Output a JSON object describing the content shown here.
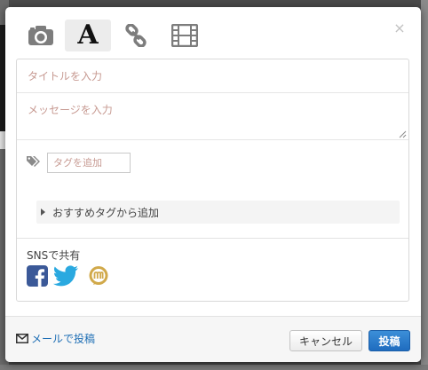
{
  "toolbar": {
    "items": [
      {
        "icon": "camera-icon"
      },
      {
        "icon": "text-icon",
        "glyph": "A",
        "active": true
      },
      {
        "icon": "link-icon"
      },
      {
        "icon": "film-icon"
      }
    ],
    "close_glyph": "×"
  },
  "form": {
    "title_placeholder": "タイトルを入力",
    "message_placeholder": "メッセージを入力",
    "tag_placeholder": "タグを追加",
    "recommend_label": "おすすめタグから追加"
  },
  "share": {
    "label": "SNSで共有",
    "services": [
      "facebook-icon",
      "twitter-icon",
      "mixi-icon"
    ]
  },
  "footer": {
    "mail_label": "メールで投稿",
    "cancel_label": "キャンセル",
    "post_label": "投稿"
  },
  "colors": {
    "placeholder": "#c79a92",
    "link": "#1f6fb5",
    "primary": "#1f6cbf",
    "facebook": "#3b5998",
    "twitter": "#2aa9e0",
    "mixi": "#d1a94a"
  }
}
